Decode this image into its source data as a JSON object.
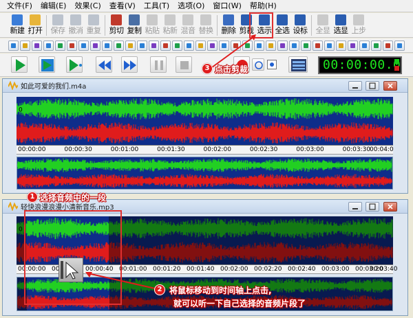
{
  "menu": [
    "文件(F)",
    "编辑(E)",
    "效果(C)",
    "查看(V)",
    "工具(T)",
    "选项(O)",
    "窗口(W)",
    "帮助(H)"
  ],
  "toolbar1": [
    {
      "label": "新建",
      "icon": "new-file-icon",
      "color": "#3b7dd8",
      "enabled": true
    },
    {
      "label": "打开",
      "icon": "open-folder-icon",
      "color": "#e8b53a",
      "enabled": true
    },
    {
      "label": "保存",
      "icon": "save-icon",
      "color": "#7a8aa0",
      "enabled": false
    },
    {
      "label": "撤消",
      "icon": "undo-icon",
      "color": "#7a8aa0",
      "enabled": false
    },
    {
      "label": "重复",
      "icon": "redo-icon",
      "color": "#7a8aa0",
      "enabled": false
    },
    {
      "label": "剪切",
      "icon": "scissors-icon",
      "color": "#c0392b",
      "enabled": true
    },
    {
      "label": "复制",
      "icon": "copy-icon",
      "color": "#4a6fa5",
      "enabled": true
    },
    {
      "label": "粘贴",
      "icon": "paste-icon",
      "color": "#9a9a9a",
      "enabled": false
    },
    {
      "label": "粘新",
      "icon": "paste-new-icon",
      "color": "#9a9a9a",
      "enabled": false
    },
    {
      "label": "混音",
      "icon": "mix-paste-icon",
      "color": "#9a9a9a",
      "enabled": false
    },
    {
      "label": "替换",
      "icon": "replace-icon",
      "color": "#9a9a9a",
      "enabled": false
    },
    {
      "label": "删除",
      "icon": "delete-icon",
      "color": "#3a6cc0",
      "enabled": true
    },
    {
      "label": "剪裁",
      "icon": "trim-icon",
      "color": "#2a5db0",
      "enabled": true
    },
    {
      "label": "选示",
      "icon": "select-view-icon",
      "color": "#2a5db0",
      "enabled": true
    },
    {
      "label": "全选",
      "icon": "select-all-icon",
      "color": "#2a5db0",
      "enabled": true
    },
    {
      "label": "设标",
      "icon": "set-marker-icon",
      "color": "#2a5db0",
      "enabled": true
    },
    {
      "label": "全显",
      "icon": "show-all-icon",
      "color": "#9a9a9a",
      "enabled": false
    },
    {
      "label": "选显",
      "icon": "zoom-selection-icon",
      "color": "#2a5db0",
      "enabled": true
    },
    {
      "label": "上步",
      "icon": "previous-step-icon",
      "color": "#9a9a9a",
      "enabled": false
    }
  ],
  "toolbar2_icons": [
    "#2a7fd6",
    "#d9a516",
    "#7a3cc0",
    "#2a7fd6",
    "#1ea04a",
    "#c23a2a",
    "#2a7fd6",
    "#7a3cc0",
    "#2a7fd6",
    "#1ea04a",
    "#d9a516",
    "#2a7fd6",
    "#7a3cc0",
    "#c23a2a",
    "#1ea04a",
    "#2a7fd6",
    "#d9a516",
    "#7a3cc0",
    "#2a7fd6",
    "#c23a2a",
    "#1ea04a",
    "#2a7fd6",
    "#d9a516",
    "#7a3cc0",
    "#2a7fd6",
    "#1ea04a",
    "#c23a2a",
    "#2a7fd6",
    "#d9a516",
    "#7a3cc0",
    "#2a7fd6",
    "#1ea04a",
    "#c23a2a",
    "#2a7fd6"
  ],
  "transport": {
    "time": "00:00:00.0",
    "buttons": [
      "play-icon",
      "play-to-end-icon",
      "play-from-cursor-icon",
      "rewind-icon",
      "fast-forward-icon",
      "pause-icon",
      "stop-icon",
      "record-icon",
      "loop-icon"
    ]
  },
  "annotations": {
    "step1": {
      "num": "1",
      "text": "选择音频中的一段"
    },
    "step2": {
      "num": "2",
      "text_line1": "将鼠标移动到时间轴上点击,",
      "text_line2": "就可以听一下自己选择的音频片段了"
    },
    "step3": {
      "num": "3",
      "text": "点击剪裁"
    }
  },
  "window1": {
    "title": "如此可爱的我们.m4a",
    "timeline": [
      "00:00:00",
      "00:00:30",
      "00:01:00",
      "00:01:30",
      "00:02:00",
      "00:02:30",
      "00:03:00",
      "00:03:30",
      "00:04:0"
    ],
    "channel_label": "0"
  },
  "window2": {
    "title": "轻快浪漫浪漫小清新音乐.mp3",
    "timeline": [
      "00:00:00",
      "00:00:20",
      "00:00:40",
      "00:01:00",
      "00:01:20",
      "00:01:40",
      "00:02:00",
      "00:02:20",
      "00:02:40",
      "00:03:00",
      "00:03:20",
      "00:03:40"
    ],
    "channel_label": "0"
  },
  "colors": {
    "wave_left": "#22d022",
    "wave_right": "#e01c1c",
    "wave_bg": "#ffffff",
    "selection_bg": "#ffffff",
    "annotation": "#e01c1c"
  }
}
